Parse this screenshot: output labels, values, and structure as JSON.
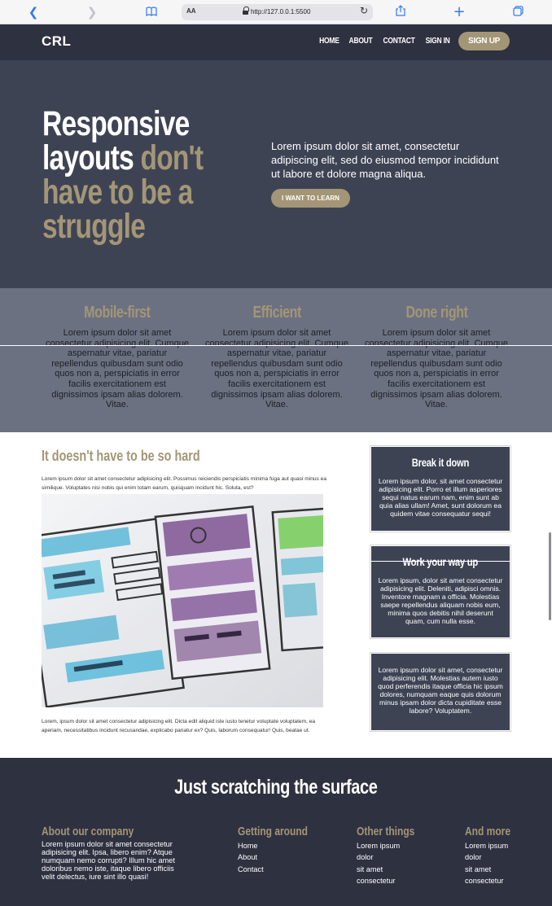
{
  "browser": {
    "text_size_label": "AA",
    "url": "http://127.0.0.1:5500"
  },
  "header": {
    "logo": "CRL",
    "nav": [
      "HOME",
      "ABOUT",
      "CONTACT",
      "SIGN IN"
    ],
    "signup": "SIGN UP"
  },
  "hero": {
    "title_part1": "Responsive layouts ",
    "title_part2": "don't have to be a struggle",
    "text": "Lorem ipsum dolor sit amet, consectetur adipiscing elit, sed do eiusmod tempor incididunt ut labore et dolore magna aliqua.",
    "button": "I WANT TO LEARN"
  },
  "features": [
    {
      "title": "Mobile-first",
      "text": "Lorem ipsum dolor sit amet consectetur adipisicing elit. Cumque aspernatur vitae, pariatur repellendus quibusdam sunt odio quos non a, perspiciatis in error facilis exercitationem est dignissimos ipsam alias dolorem. Vitae."
    },
    {
      "title": "Efficient",
      "text": "Lorem ipsum dolor sit amet consectetur adipisicing elit. Cumque aspernatur vitae, pariatur repellendus quibusdam sunt odio quos non a, perspiciatis in error facilis exercitationem est dignissimos ipsam alias dolorem. Vitae."
    },
    {
      "title": "Done right",
      "text": "Lorem ipsum dolor sit amet consectetur adipisicing elit. Cumque aspernatur vitae, pariatur repellendus quibusdam sunt odio quos non a, perspiciatis in error facilis exercitationem est dignissimos ipsam alias dolorem. Vitae."
    }
  ],
  "article": {
    "title": "It doesn't have to be so hard",
    "intro": "Lorem ipsum dolor sit amet consectetur adipisicing elit. Possimus reiciendis perspiciatis minima fuga aut quasi minus ea similique. Voluptates nisi nobis qui enim totam earum, quisquam incidunt hic. Soluta, est?",
    "outro": "Lorem, ipsum dolor sit amet consectetur adipisicing elit. Dicta edit aliquid iste iusto tenetur voluptate voluptatem, ea aperiam, necessitatibus incidunt recusandae, explicabo pariatur ex? Quis, laborum consequatur! Quis, beatae ut."
  },
  "cards": [
    {
      "title": "Break it down",
      "text": "Lorem ipsum dolor, sit amet consectetur adipisicing elit. Porro et illum asperiores sequi natus earum nam, enim sunt ab quia alias ullam! Amet, sunt dolorum ea quidem vitae consequatur sequi!"
    },
    {
      "title": "Work your way up",
      "text": "Lorem ipsum, dolor sit amet consectetur adipisicing elit. Deleniti, adipisci omnis. Inventore magnam a officia. Molestias saepe repellendus aliquam nobis eum, minima quos debitis nihil deserunt quam, cum nulla esse."
    },
    {
      "title": "",
      "text": "Lorem ipsum dolor sit amet, consectetur adipisicing elit. Molestias autem iusto quod perferendis itaque officia hic ipsum dolores, numquam eaque quis dolorum minus ipsam dolor dicta cupiditate esse labore? Voluptatem."
    }
  ],
  "footer": {
    "heading": "Just scratching the surface",
    "about": {
      "title": "About our company",
      "text": "Lorem ipsum dolor sit amet consectetur adipisicing elit. Ipsa, libero enim? Atque numquam nemo corrupti? Illum hic amet doloribus nemo iste, itaque libero officiis velit delectus, iure sint illo quasi!"
    },
    "columns": [
      {
        "title": "Getting around",
        "items": [
          "Home",
          "About",
          "Contact"
        ]
      },
      {
        "title": "Other things",
        "items": [
          "Lorem ipsum",
          "dolor",
          "sit amet",
          "consectetur"
        ]
      },
      {
        "title": "And more",
        "items": [
          "Lorem ipsum",
          "dolor",
          "sit amet",
          "consectetur"
        ]
      }
    ]
  },
  "colors": {
    "accent": "#a39676",
    "header_bg": "#2e3140",
    "hero_bg": "#3e4354",
    "features_bg": "#6c7181"
  }
}
